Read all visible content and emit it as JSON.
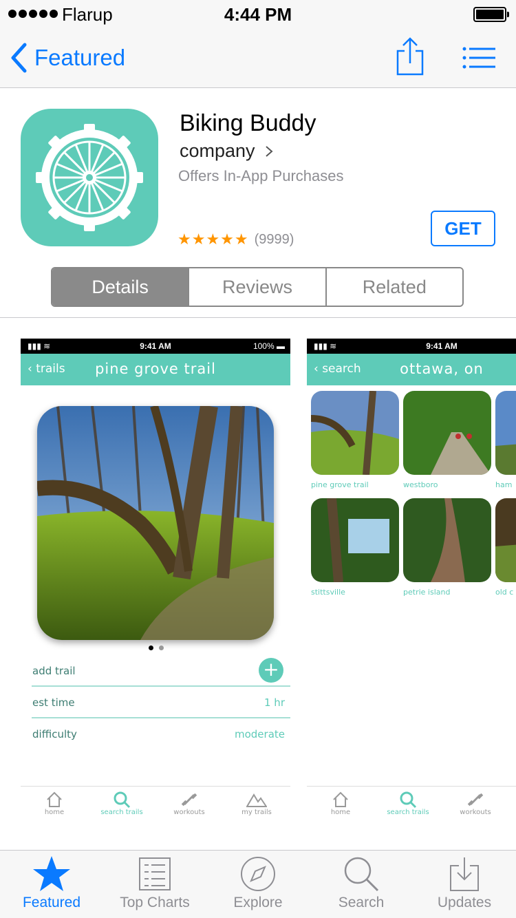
{
  "status_bar": {
    "carrier": "Flarup",
    "time": "4:44 PM"
  },
  "nav": {
    "back_label": "Featured"
  },
  "app": {
    "name": "Biking Buddy",
    "company": "company",
    "iap": "Offers In-App Purchases",
    "stars": "★★★★★",
    "rating_count": "(9999)",
    "get_label": "GET"
  },
  "segments": [
    "Details",
    "Reviews",
    "Related"
  ],
  "screenshot1": {
    "status_time": "9:41 AM",
    "status_battery": "100%",
    "back": "trails",
    "title": "pine grove trail",
    "rows": [
      {
        "label": "add trail",
        "value": ""
      },
      {
        "label": "est time",
        "value": "1 hr"
      },
      {
        "label": "difficulty",
        "value": "moderate"
      }
    ],
    "tabs": [
      "home",
      "search trails",
      "workouts",
      "my trails"
    ]
  },
  "screenshot2": {
    "status_time": "9:41 AM",
    "back": "search",
    "title": "ottawa, on",
    "places": [
      "pine grove trail",
      "westboro",
      "ham",
      "stittsville",
      "petrie island",
      "old c"
    ],
    "tabs": [
      "home",
      "search trails",
      "workouts"
    ]
  },
  "tabbar": [
    "Featured",
    "Top Charts",
    "Explore",
    "Search",
    "Updates"
  ],
  "colors": {
    "accent": "#0a7aff",
    "teal": "#5ecbb8",
    "star": "#ff9500"
  }
}
